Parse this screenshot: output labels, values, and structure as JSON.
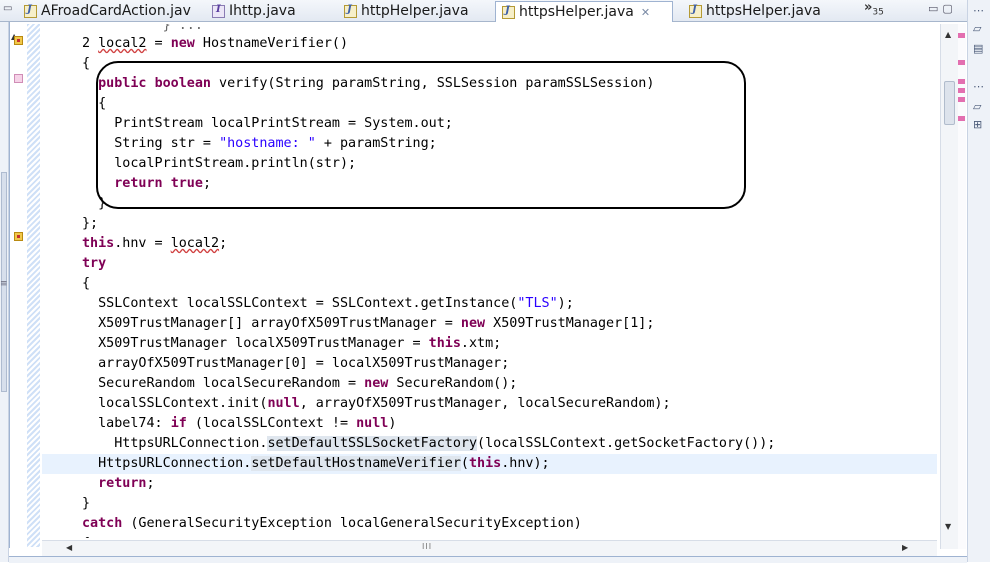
{
  "tabs": [
    {
      "label": "AFroadCardAction.jav",
      "icon": "java-file-icon",
      "active": false
    },
    {
      "label": "Ihttp.java",
      "icon": "java-interface-icon",
      "active": false
    },
    {
      "label": "httpHelper.java",
      "icon": "java-file-icon",
      "active": false
    },
    {
      "label": "httpsHelper.java",
      "icon": "java-file-icon",
      "active": true,
      "close": "✕"
    },
    {
      "label": "httpsHelper.java",
      "icon": "java-file-icon",
      "active": false
    }
  ],
  "overflow": {
    "chevron": "»",
    "count": "35"
  },
  "scroll_symbols": {
    "up": "▲",
    "down": "▼",
    "left": "◀",
    "right": "▶",
    "grip": "III"
  },
  "code": {
    "top_partial": "          } ...",
    "lines": [
      {
        "segs": [
          {
            "t": "2 "
          },
          {
            "t": "local2",
            "c": "sq"
          },
          {
            "t": " = "
          },
          {
            "t": "new",
            "c": "kw"
          },
          {
            "t": " HostnameVerifier()"
          }
        ]
      },
      {
        "segs": [
          {
            "t": "{"
          }
        ]
      },
      {
        "segs": [
          {
            "t": "  "
          },
          {
            "t": "public",
            "c": "kw"
          },
          {
            "t": " "
          },
          {
            "t": "boolean",
            "c": "kw"
          },
          {
            "t": " verify(String paramString, SSLSession paramSSLSession)"
          }
        ]
      },
      {
        "segs": [
          {
            "t": "  {"
          }
        ]
      },
      {
        "segs": [
          {
            "t": "    PrintStream localPrintStream = System.out;"
          }
        ]
      },
      {
        "segs": [
          {
            "t": "    String str = "
          },
          {
            "t": "\"hostname: \"",
            "c": "str"
          },
          {
            "t": " + paramString;"
          }
        ]
      },
      {
        "segs": [
          {
            "t": "    localPrintStream.println(str);"
          }
        ]
      },
      {
        "segs": [
          {
            "t": "    "
          },
          {
            "t": "return",
            "c": "kw"
          },
          {
            "t": " "
          },
          {
            "t": "true",
            "c": "kw"
          },
          {
            "t": ";"
          }
        ]
      },
      {
        "segs": [
          {
            "t": "  }"
          }
        ]
      },
      {
        "segs": [
          {
            "t": "};"
          }
        ]
      },
      {
        "segs": [
          {
            "t": "this",
            "c": "kw"
          },
          {
            "t": ".hnv = "
          },
          {
            "t": "local2",
            "c": "sq"
          },
          {
            "t": ";"
          }
        ]
      },
      {
        "segs": [
          {
            "t": "try",
            "c": "kw"
          }
        ]
      },
      {
        "segs": [
          {
            "t": "{"
          }
        ]
      },
      {
        "segs": [
          {
            "t": "  SSLContext localSSLContext = SSLContext.getInstance("
          },
          {
            "t": "\"TLS\"",
            "c": "str"
          },
          {
            "t": ");"
          }
        ]
      },
      {
        "segs": [
          {
            "t": "  X509TrustManager[] arrayOfX509TrustManager = "
          },
          {
            "t": "new",
            "c": "kw"
          },
          {
            "t": " X509TrustManager[1];"
          }
        ]
      },
      {
        "segs": [
          {
            "t": "  X509TrustManager localX509TrustManager = "
          },
          {
            "t": "this",
            "c": "kw"
          },
          {
            "t": ".xtm;"
          }
        ]
      },
      {
        "segs": [
          {
            "t": "  arrayOfX509TrustManager[0] = localX509TrustManager;"
          }
        ]
      },
      {
        "segs": [
          {
            "t": "  SecureRandom localSecureRandom = "
          },
          {
            "t": "new",
            "c": "kw"
          },
          {
            "t": " SecureRandom();"
          }
        ]
      },
      {
        "segs": [
          {
            "t": "  localSSLContext.init("
          },
          {
            "t": "null",
            "c": "kw"
          },
          {
            "t": ", arrayOfX509TrustManager, localSecureRandom);"
          }
        ]
      },
      {
        "segs": [
          {
            "t": "  label74: "
          },
          {
            "t": "if",
            "c": "kw"
          },
          {
            "t": " (localSSLContext != "
          },
          {
            "t": "null",
            "c": "kw"
          },
          {
            "t": ")"
          }
        ]
      },
      {
        "segs": [
          {
            "t": "    HttpsURLConnection."
          },
          {
            "t": "setDefaultSSLSocketFactory",
            "c": "occ"
          },
          {
            "t": "(localSSLContext.getSocketFactory());"
          }
        ]
      },
      {
        "segs": [
          {
            "t": "  HttpsURLConnection."
          },
          {
            "t": "setDefaultHostnameVerifier",
            "c": "occ"
          },
          {
            "t": "("
          },
          {
            "t": "this",
            "c": "kw"
          },
          {
            "t": ".hnv);"
          }
        ],
        "hl": true
      },
      {
        "segs": [
          {
            "t": "  "
          },
          {
            "t": "return",
            "c": "kw"
          },
          {
            "t": ";"
          }
        ]
      },
      {
        "segs": [
          {
            "t": "}"
          }
        ]
      },
      {
        "segs": [
          {
            "t": "catch",
            "c": "kw"
          },
          {
            "t": " (GeneralSecurityException localGeneralSecurityException)"
          }
        ]
      },
      {
        "segs": [
          {
            "t": "{"
          }
        ]
      }
    ]
  }
}
